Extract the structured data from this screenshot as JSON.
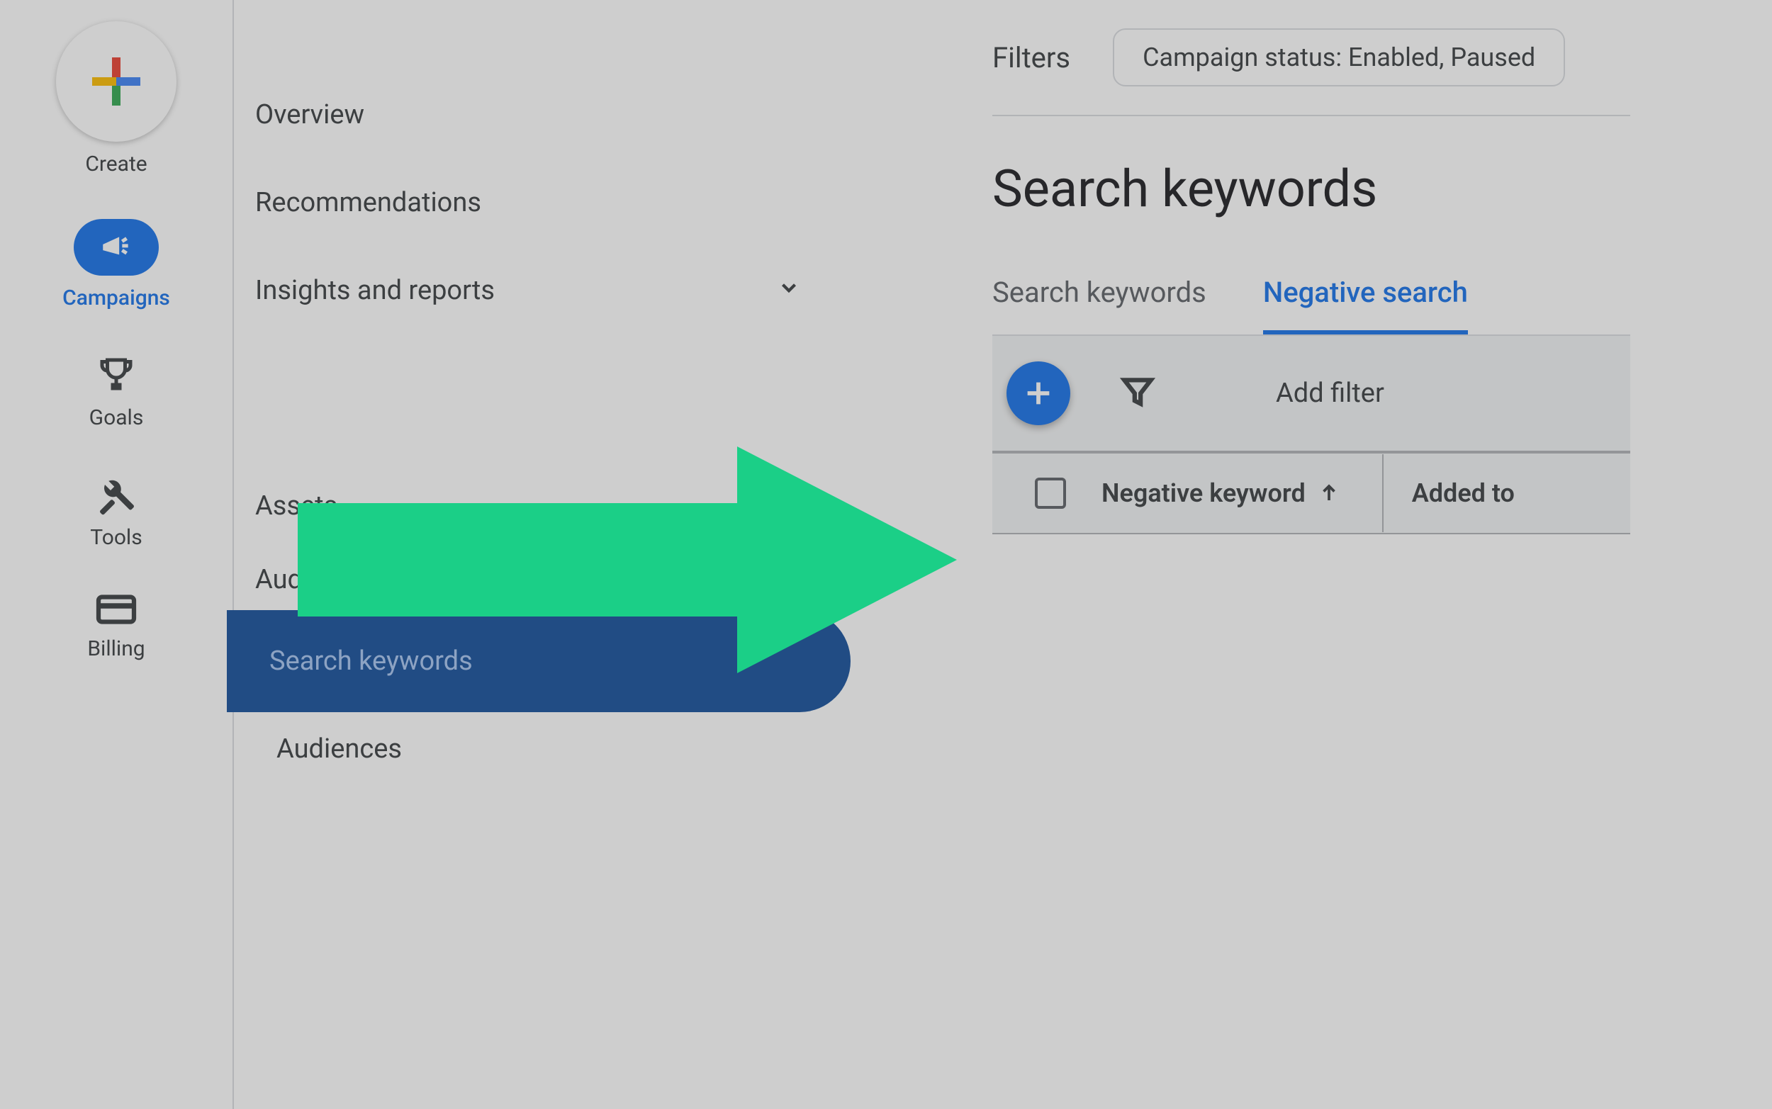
{
  "rail": {
    "create": "Create",
    "campaigns": "Campaigns",
    "goals": "Goals",
    "tools": "Tools",
    "billing": "Billing"
  },
  "nav": {
    "overview": "Overview",
    "recommendations": "Recommendations",
    "insights": "Insights and reports",
    "assets": "Assets",
    "akc": "Audiences, keywords, and content",
    "search_keywords": "Search keywords",
    "audiences": "Audiences"
  },
  "main": {
    "filters_label": "Filters",
    "filter_chip": "Campaign status: Enabled, Paused",
    "page_title": "Search keywords",
    "tabs": {
      "search": "Search keywords",
      "negative": "Negative search"
    },
    "add_filter": "Add filter",
    "th_negative": "Negative keyword",
    "th_added": "Added to"
  }
}
